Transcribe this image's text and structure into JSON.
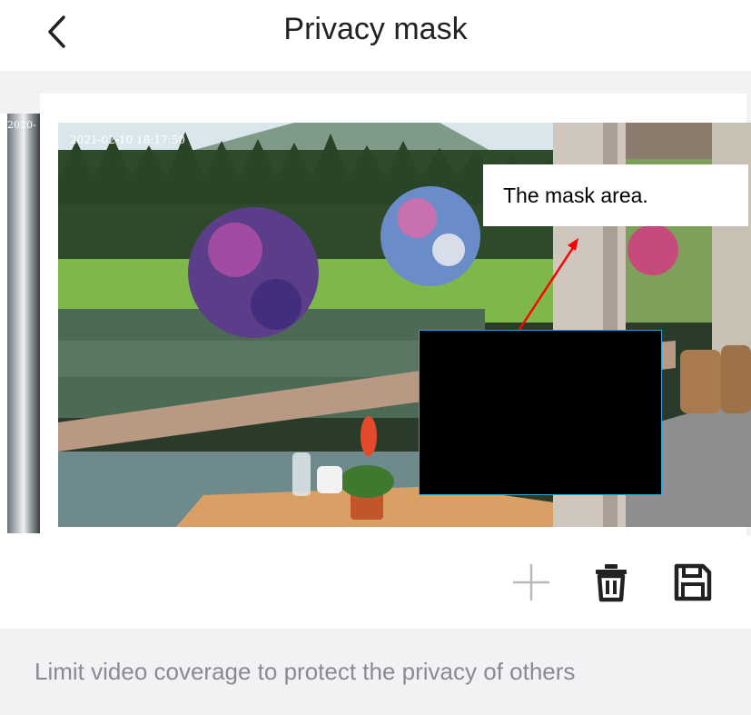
{
  "header": {
    "title": "Privacy mask",
    "back_icon": "chevron-left-icon"
  },
  "preview": {
    "side_thumbnail_timestamp": "2020-",
    "camera_timestamp": "2021-02-10 18:17:50",
    "callout_text": "The mask area.",
    "callout_arrow_color": "#ff0000",
    "mask_color": "#000000",
    "mask_border_color": "#2aa8d8"
  },
  "toolbar": {
    "add_icon": "plus-icon",
    "delete_icon": "trash-icon",
    "save_icon": "floppy-disk-icon"
  },
  "footer": {
    "description": "Limit video coverage to protect the privacy of others"
  },
  "colors": {
    "background": "#ffffff",
    "band": "#f2f2f4",
    "description_text": "#8a8a8f",
    "title_text": "#222222"
  }
}
